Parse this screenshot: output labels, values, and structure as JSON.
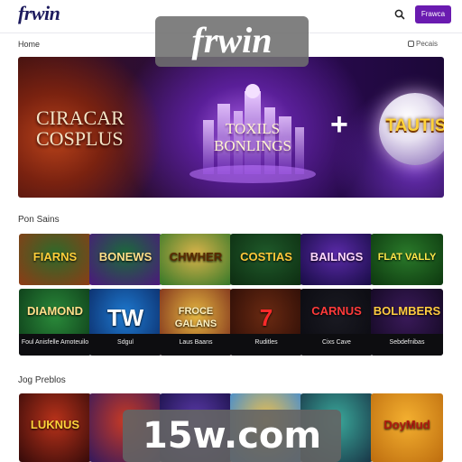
{
  "header": {
    "logo": "frwin",
    "search_icon": "search-icon",
    "cta_label": "Frawca"
  },
  "breadcrumb": {
    "home": "Home",
    "right_label": "Pecais"
  },
  "watermark": {
    "top": "frwin",
    "bottom": "15w.com"
  },
  "hero": {
    "left_text": "CIRACAR COSPLUS",
    "center_text": "TOXILS BONLINGS",
    "plus": "+",
    "right_text": "TAUTIS"
  },
  "sections": {
    "popular_title": "Pon Sains",
    "providers_title": "Jog Preblos"
  },
  "row1": [
    {
      "title": "FIARNS",
      "color_a": "#2d6a2a",
      "color_b": "#8a3d16",
      "text_color": "#ffcf3a"
    },
    {
      "title": "BONEWS",
      "color_a": "#1a6b3a",
      "color_b": "#4a1a7a",
      "text_color": "#ffe08a"
    },
    {
      "title": "CHWHER",
      "color_a": "#d9b34a",
      "color_b": "#3a7a2a",
      "text_color": "#5a2a00"
    },
    {
      "title": "COSTIAS",
      "color_a": "#1f5a2a",
      "color_b": "#0e2e12",
      "text_color": "#ffc93a"
    },
    {
      "title": "BAILNGS",
      "color_a": "#5a2aa8",
      "color_b": "#1a0d48",
      "text_color": "#ffd6ff"
    },
    {
      "title": "FLAT VALLY",
      "color_a": "#2a7a2a",
      "color_b": "#0e3a10",
      "text_color": "#ffe94a"
    }
  ],
  "row2": [
    {
      "title": "DIAMOND",
      "caption": "Foul Anisfelle Amoteuilo",
      "color_a": "#2a8a3a",
      "color_b": "#0d3a18",
      "text_color": "#ffe08a"
    },
    {
      "title": "TW",
      "caption": "Sdgul",
      "color_a": "#1e7ad0",
      "color_b": "#0b2a66",
      "text_color": "#ffffff"
    },
    {
      "title": "FROCE GALANS",
      "caption": "Laus Baans",
      "color_a": "#e4b640",
      "color_b": "#7a2a1a",
      "text_color": "#fff2c0"
    },
    {
      "title": "7",
      "caption": "Ruditles",
      "color_a": "#6a2a12",
      "color_b": "#2a0c06",
      "text_color": "#ff2a2a"
    },
    {
      "title": "CARNUS",
      "caption": "Cixs Cave",
      "color_a": "#1a1a22",
      "color_b": "#0a0a10",
      "text_color": "#ff3a3a"
    },
    {
      "title": "BOLMBERS",
      "caption": "Sebdefnibas",
      "color_a": "#3a1a5a",
      "color_b": "#120820",
      "text_color": "#ffcc40"
    }
  ],
  "row3": [
    {
      "title": "LUKNUS",
      "color_a": "#b8321a",
      "color_b": "#3a0c0a",
      "text_color": "#ffd23a"
    },
    {
      "title": "",
      "color_a": "#c83a24",
      "color_b": "#3a1a5a",
      "text_color": "#ffffff"
    },
    {
      "title": "",
      "color_a": "#5a3aa8",
      "color_b": "#1a1048",
      "text_color": "#ffffff"
    },
    {
      "title": "",
      "color_a": "#f0c04a",
      "color_b": "#3a8ad8",
      "text_color": "#ffffff"
    },
    {
      "title": "",
      "color_a": "#3aa89a",
      "color_b": "#1a3a4a",
      "text_color": "#ffffff"
    },
    {
      "title": "DoyMud",
      "color_a": "#f4b030",
      "color_b": "#c07010",
      "text_color": "#b01a10"
    }
  ],
  "colors": {
    "brand": "#1d1b5e",
    "accent": "#6a1bb0"
  }
}
